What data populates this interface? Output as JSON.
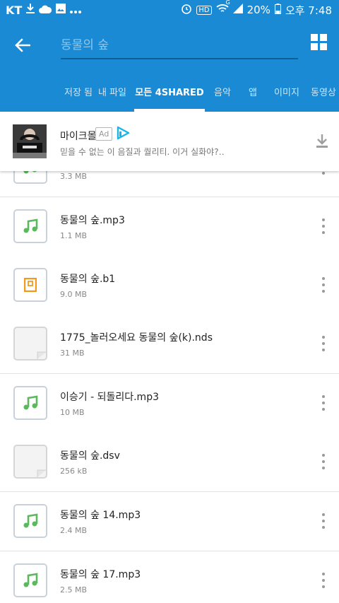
{
  "status_bar": {
    "carrier": "KT",
    "hd": "HD",
    "network": "G",
    "battery": "20%",
    "time": "오후 7:48",
    "icons": [
      "download-icon",
      "cloud-icon",
      "image-icon",
      "more-dots-icon",
      "alarm-icon",
      "wifi-icon",
      "signal-icon",
      "battery-icon"
    ]
  },
  "app_bar": {
    "search_value": "동물의 숲",
    "back_icon": "arrow-left-icon",
    "view_icon": "grid-view-icon"
  },
  "tabs": [
    {
      "label": "저장 됨"
    },
    {
      "label": "내 파일"
    },
    {
      "label": "모든 4SHARED"
    },
    {
      "label": "음악"
    },
    {
      "label": "앱"
    },
    {
      "label": "이미지"
    },
    {
      "label": "동영상"
    }
  ],
  "active_tab": "모든 4SHARED",
  "ad": {
    "title": "마이크몰",
    "badge": "Ad",
    "description": "믿을 수 없는 이 음질과 퀄리티. 이거 실화야?‥"
  },
  "files": [
    {
      "name": "",
      "size": "3.3 MB",
      "icon": "music-note-icon"
    },
    {
      "name": "동물의 숲.mp3",
      "size": "1.1 MB",
      "icon": "music-note-icon"
    },
    {
      "name": "동물의 숲.b1",
      "size": "9.0 MB",
      "icon": "archive-icon"
    },
    {
      "name": "1775_놀러오세요 동물의 숲(k).nds",
      "size": "31 MB",
      "icon": "document-icon"
    },
    {
      "name": "이승기 - 되돌리다.mp3",
      "size": "10 MB",
      "icon": "music-note-icon"
    },
    {
      "name": "동물의 숲.dsv",
      "size": "256 kB",
      "icon": "document-icon"
    },
    {
      "name": "동물의 숲 14.mp3",
      "size": "2.4 MB",
      "icon": "music-note-icon"
    },
    {
      "name": "동물의 숲 17.mp3",
      "size": "2.5 MB",
      "icon": "music-note-icon"
    }
  ],
  "colors": {
    "primary": "#1a8ad4",
    "music": "#5cb85c",
    "archive": "#f29a1f"
  }
}
